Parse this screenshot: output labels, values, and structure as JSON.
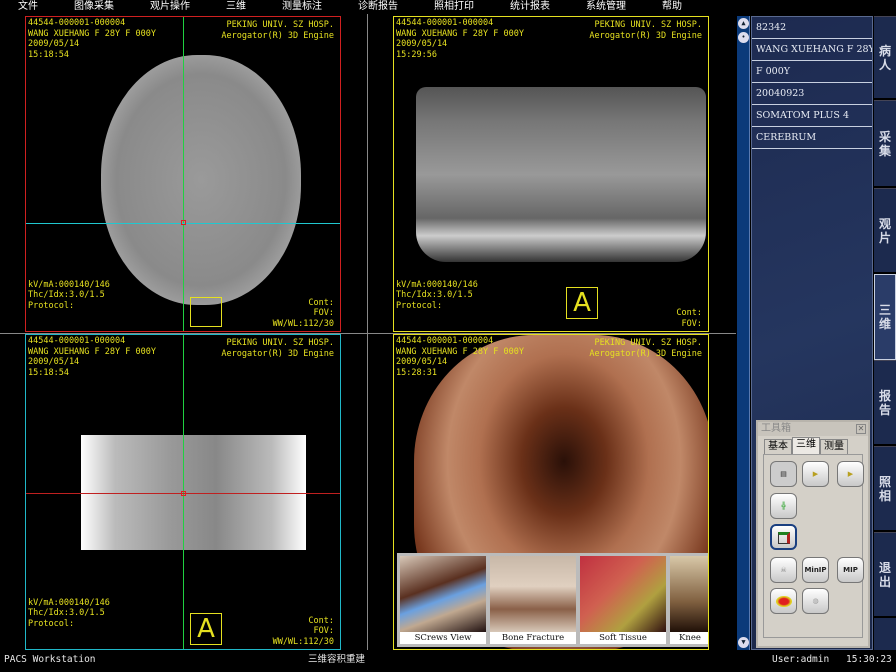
{
  "menu": [
    "文件",
    "图像采集",
    "观片操作",
    "三维",
    "测量标注",
    "诊断报告",
    "照相打印",
    "统计报表",
    "系统管理",
    "帮助"
  ],
  "colors": {
    "frame_active": "#d02020",
    "frame_yellow": "#e5e020",
    "frame_cyan": "#20b8c8",
    "overlay_text": "#e5e020",
    "panel_bg": "#1d2a50"
  },
  "viewports": [
    {
      "id": "axial",
      "study": "44544-000001-000004",
      "patient": "WANG XUEHANG F 28Y F 000Y",
      "date": "2009/05/14",
      "time": "15:18:54",
      "hospital": "PEKING UNIV. SZ HOSP.",
      "engine": "Aerogator(R) 3D Engine",
      "kv": "kV/mA:000140/146",
      "thc": "Thc/Idx:3.0/1.5",
      "protocol": "Protocol:",
      "cont": "Cont:",
      "fov": "FOV:",
      "wwwl": "WW/WL:112/30"
    },
    {
      "id": "volume",
      "study": "44544-000001-000004",
      "patient": "WANG XUEHANG F 28Y F 000Y",
      "date": "2009/05/14",
      "time": "15:29:56",
      "hospital": "PEKING UNIV. SZ HOSP.",
      "engine": "Aerogator(R) 3D Engine",
      "kv": "kV/mA:000140/146",
      "thc": "Thc/Idx:3.0/1.5",
      "protocol": "Protocol:",
      "cont": "Cont:",
      "fov": "FOV:",
      "orientation": "A"
    },
    {
      "id": "coronal",
      "study": "44544-000001-000004",
      "patient": "WANG XUEHANG F 28Y F 000Y",
      "date": "2009/05/14",
      "time": "15:18:54",
      "hospital": "PEKING UNIV. SZ HOSP.",
      "engine": "Aerogator(R) 3D Engine",
      "kv": "kV/mA:000140/146",
      "thc": "Thc/Idx:3.0/1.5",
      "protocol": "Protocol:",
      "cont": "Cont:",
      "fov": "FOV:",
      "wwwl": "WW/WL:112/30",
      "orientation": "A"
    },
    {
      "id": "vr",
      "study": "44544-000001-000004",
      "patient": "WANG XUEHANG F 28Y F 000Y",
      "date": "2009/05/14",
      "time": "15:28:31",
      "hospital": "PEKING UNIV. SZ HOSP.",
      "engine": "Aerogator(R) 3D Engine"
    }
  ],
  "presets": [
    "SCrews View",
    "Bone Fracture",
    "Soft Tissue",
    "Knee"
  ],
  "info": [
    "82342",
    "WANG XUEHANG F 28Y",
    "F 000Y",
    "20040923",
    "SOMATOM PLUS 4",
    "CEREBRUM"
  ],
  "tabs": [
    "病人",
    "采集",
    "观片",
    "三维",
    "报告",
    "照相",
    "退出"
  ],
  "active_tab": "三维",
  "toolbox": {
    "title": "工具箱",
    "tabs": [
      "基本",
      "三维",
      "测量"
    ],
    "active_tab": "三维",
    "minip": "MinIP",
    "mip": "MIP"
  },
  "status": {
    "app": "PACS Workstation",
    "mode": "三维容积重建",
    "user": "User:admin",
    "clock": "15:30:23"
  }
}
